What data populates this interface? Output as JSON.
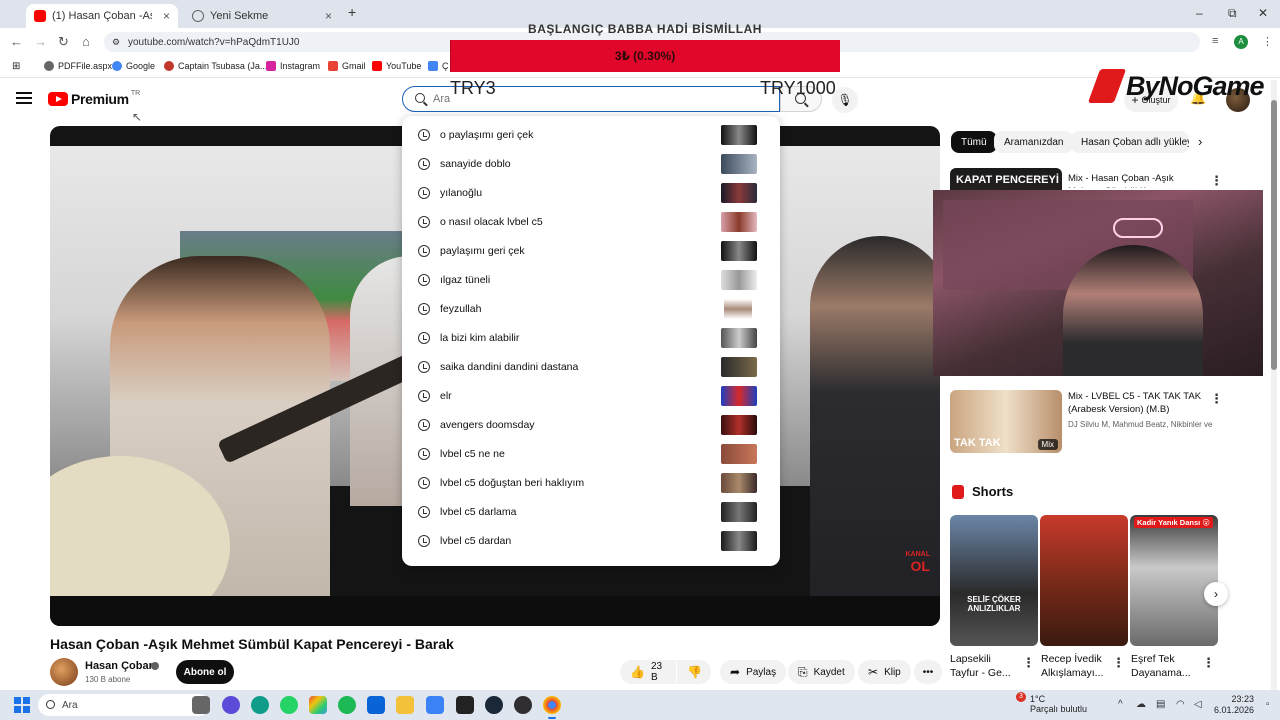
{
  "browser": {
    "tabs": [
      {
        "label": "(1) Hasan Çoban -Aşık Mehmet",
        "close": "×"
      },
      {
        "label": "Yeni Sekme",
        "close": "×"
      }
    ],
    "new_tab": "+",
    "window_controls": {
      "minimize": "–",
      "maximize": "⧉",
      "close": "✕"
    },
    "nav": {
      "back": "←",
      "forward": "→",
      "reload": "↻",
      "home": "⌂"
    },
    "url": "youtube.com/watch?v=hPaQdmT1UJ0",
    "profile_initial": "A",
    "bookmarks": [
      "PDFFile.aspx",
      "Google",
      "Captain Tsubasa (Ja...",
      "Instagram",
      "Gmail",
      "YouTube",
      "Ç"
    ]
  },
  "overlay": {
    "goal_title": "BAŞLANGIÇ BABBA HADİ BİSMİLLAH",
    "goal_amount": "3₺ (0.30%)",
    "goal_progress": 0.003,
    "goal_min": "TRY3",
    "goal_max": "TRY1000",
    "sponsor": "ByNoGame"
  },
  "youtube": {
    "logo_text": "Premium",
    "logo_region": "TR",
    "search": {
      "placeholder": "Ara",
      "value": ""
    },
    "create_label": "Oluştur",
    "notification_count": "9+",
    "suggestions": [
      "o paylaşımı geri çek",
      "sanayide doblo",
      "yılanoğlu",
      "o nasıl olacak lvbel c5",
      "paylaşımı geri çek",
      "ılgaz tüneli",
      "feyzullah",
      "la bizi kim alabilir",
      "saika dandini dandini dastana",
      "elr",
      "avengers doomsday",
      "lvbel c5 ne ne",
      "lvbel c5 doğuştan beri haklıyım",
      "lvbel c5 darlama",
      "lvbel c5 dardan"
    ],
    "video": {
      "title": "Hasan Çoban -Aşık Mehmet Sümbül Kapat Pencereyi - Barak",
      "watermark_small": "KANAL",
      "watermark": "OL",
      "channel_name": "Hasan Çoban",
      "subscribers": "130 B abone",
      "subscribe_label": "Abone ol",
      "likes": "23 B",
      "share_label": "Paylaş",
      "save_label": "Kaydet",
      "clip_label": "Klip",
      "more": "•••"
    },
    "sidebar": {
      "chips": [
        "Tümü",
        "Aramanızdan",
        "Hasan Çoban adlı yükleyiciden"
      ],
      "recommendations": [
        {
          "thumb_text": "KAPAT PENCEREYİ",
          "title": "Mix - Hasan Çoban -Aşık Mehmet Sümbül Kapat Pencereyi - Barak",
          "meta": ""
        },
        {
          "thumb_text": "TAK TAK",
          "title": "Mix - LVBEL C5 - TAK TAK TAK (Arabesk Version) (M.B)",
          "meta": "DJ Silviu M, Mahmud Beatz, Nikbinler ve ...",
          "badge": "Mix"
        }
      ],
      "shorts_label": "Shorts",
      "shorts": [
        {
          "title": "Lapsekili Tayfur - Ge...",
          "overlay_text": "SELİF ÇÖKER ANLIZLIKLAR"
        },
        {
          "title": "Recep İvedik Alkışlamayı...",
          "overlay_text": ""
        },
        {
          "title": "Eşref Tek Dayanama...",
          "overlay_text": "Kadir Yanık Dansı 😮"
        }
      ],
      "next": "›"
    }
  },
  "taskbar": {
    "search_placeholder": "Ara",
    "weather_temp": "1°C",
    "weather_desc": "Parçalı bulutlu",
    "weather_badge": "3",
    "time": "23:23",
    "date": "6.01.2026",
    "tray_chevron": "^"
  },
  "colors": {
    "youtube_red": "#ff0000",
    "goal_bar": "#e0072b",
    "search_focus": "#1c62b9"
  }
}
